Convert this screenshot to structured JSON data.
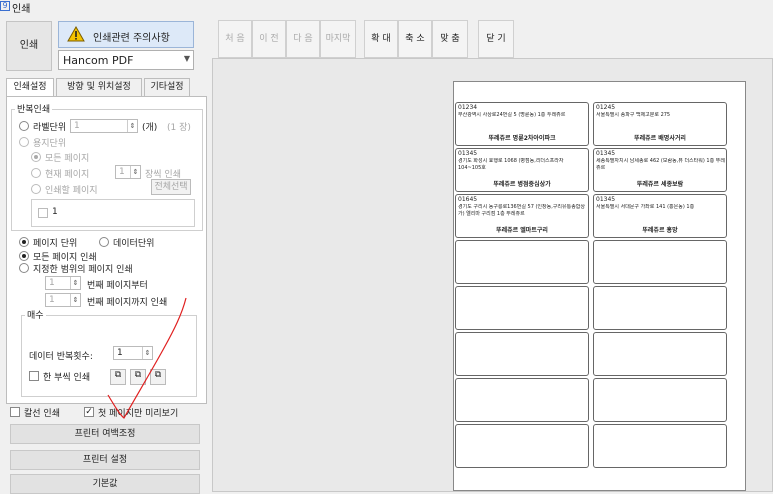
{
  "window": {
    "title": "인쇄",
    "title_icon": "print-dialog-icon"
  },
  "left_top": {
    "print_label": "인쇄",
    "warning_label": "인쇄관련 주의사항",
    "printer_value": "Hancom PDF"
  },
  "toolbar": {
    "first": "처 음",
    "prev": "이 전",
    "next": "다 음",
    "last": "마지막",
    "zoom_in": "확 대",
    "zoom_out": "축 소",
    "fit": "맞 춤",
    "close": "닫 기"
  },
  "tabs": [
    "인쇄설정",
    "방향 및 위치설정",
    "기타설정"
  ],
  "repeat": {
    "group_title": "반복인쇄",
    "label_unit": "라벨단위",
    "label_unit_value": "1",
    "label_unit_suffix": "(개)",
    "label_unit_hint": "(1 장)",
    "page_unit": "용지단위",
    "all_pages": "모든 페이지",
    "current_page": "현재 페이지",
    "current_page_value": "1",
    "pages_print": "장씩 인쇄",
    "print_page": "인쇄할 페이지",
    "select_all": "전체선택",
    "list_item": "1"
  },
  "unit": {
    "page_unit": "페이지 단위",
    "data_unit": "데이터단위",
    "all_pages_print": "모든 페이지 인쇄",
    "range_print": "지정한 범위의 페이지 인쇄",
    "from_value": "1",
    "from_label": "번째 페이지부터",
    "to_value": "1",
    "to_label": "번째 페이지까지 인쇄"
  },
  "copies": {
    "group_title": "매수",
    "data_repeat_label": "데이터 반복횟수:",
    "data_repeat_value": "1",
    "one_copy": "한 부씩 인쇄"
  },
  "bottom": {
    "cutline_print": "칼선 인쇄",
    "first_page_preview": "첫 페이지만 미리보기",
    "printer_margin": "프린터 여백조정",
    "printer_settings": "프린터 설정",
    "default": "기본값"
  },
  "labels": [
    {
      "code": "01234",
      "addr": "부산광역시 사상로24번길 5 (명륜동) 1층 두레쥬르",
      "name": "뚜레쥬르 명륜2차아이파크"
    },
    {
      "code": "01245",
      "addr": "서울특별시 송파구 백제고분로 275",
      "name": "뚜레쥬르 배명사거리"
    },
    {
      "code": "01345",
      "addr": "경기도 화성시 효행로 1068 (병점동,리더스프라자 104~105호",
      "name": "뚜레쥬르 병점중심상가"
    },
    {
      "code": "01345",
      "addr": "세종특별자치시 남세종로 462 (보람동,뷰 더스타워) 1층 뚜레쥬르",
      "name": "뚜레쥬르 세종보람"
    },
    {
      "code": "01645",
      "addr": "경기도 구리시 동구릉로136번길 57 (인창동,구리유통종합상가) 엘리마 구리점 1층 뚜레쥬르",
      "name": "뚜레쥬르 엘마트구리"
    },
    {
      "code": "01345",
      "addr": "서울특별시 서대문구 가좌로 141 (홍은동) 1층",
      "name": "뚜레쥬르 홍망"
    }
  ]
}
